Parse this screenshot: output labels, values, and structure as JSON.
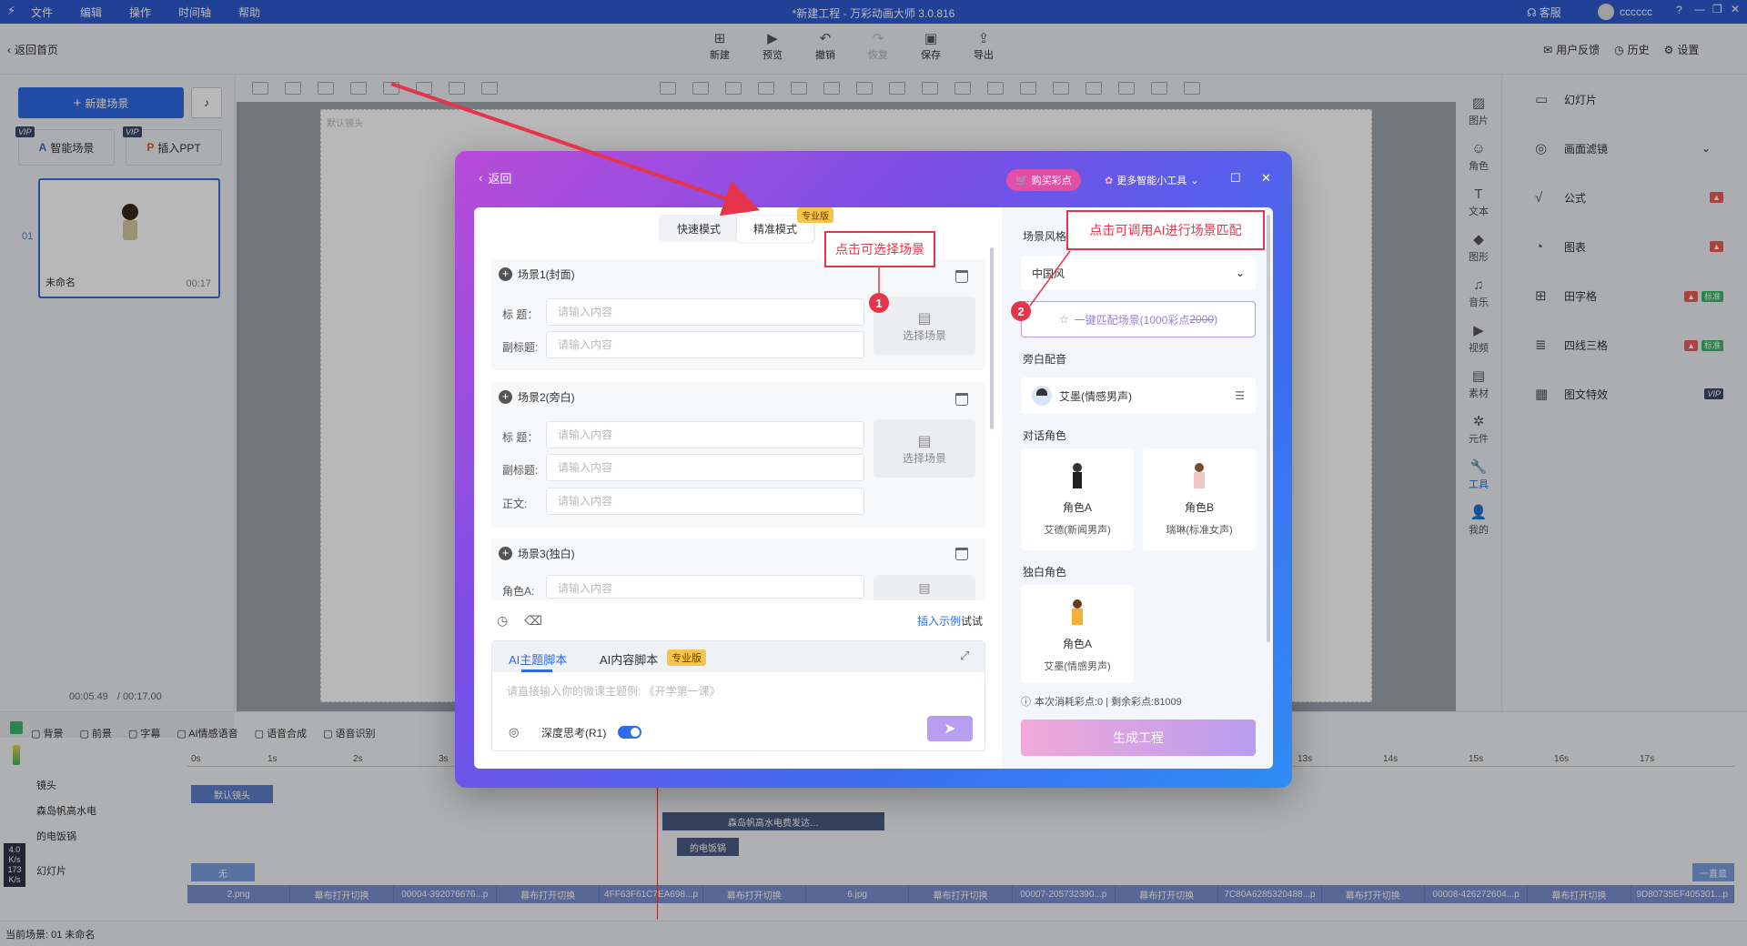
{
  "menubar": {
    "items": [
      "文件",
      "编辑",
      "操作",
      "时间轴",
      "帮助"
    ],
    "title": "*新建工程 - 万彩动画大师 3.0.816",
    "service": "客服",
    "user": "cccccc"
  },
  "toolbar": {
    "back_home": "返回首页",
    "new": "新建",
    "preview": "预览",
    "undo": "撤销",
    "redo": "恢复",
    "save": "保存",
    "export": "导出",
    "feedback": "用户反馈",
    "history": "历史",
    "settings": "设置"
  },
  "left_panel": {
    "new_scene": "新建场景",
    "smart_scene": "智能场景",
    "insert_ppt": "插入PPT",
    "vip": "VIP",
    "scene_index": "01",
    "scene_name": "未命名",
    "scene_duration": "00:17",
    "time_current": "00:05.49",
    "time_total": "/ 00:17.00"
  },
  "canvas": {
    "label": "默认镜头"
  },
  "right_bar": [
    "图片",
    "角色",
    "文本",
    "图形",
    "音乐",
    "视频",
    "素材",
    "元件",
    "工具",
    "我的"
  ],
  "right_panel": [
    {
      "label": "幻灯片",
      "icon": "slideshow-icon",
      "badges": []
    },
    {
      "label": "画面滤镜",
      "icon": "filter-icon",
      "badges": []
    },
    {
      "label": "公式",
      "icon": "formula-icon",
      "badges": [
        "hot"
      ]
    },
    {
      "label": "图表",
      "icon": "chart-icon",
      "badges": [
        "hot"
      ]
    },
    {
      "label": "田字格",
      "icon": "grid-icon",
      "badges": [
        "hot",
        "标准"
      ]
    },
    {
      "label": "四线三格",
      "icon": "lines-icon",
      "badges": [
        "hot",
        "标准"
      ]
    },
    {
      "label": "图文特效",
      "icon": "effect-icon",
      "badges": [
        "VIP"
      ]
    }
  ],
  "timeline": {
    "tabs": [
      "背景",
      "前景",
      "字幕",
      "AI情感语音",
      "语音合成",
      "语音识别"
    ],
    "ticks": [
      "0s",
      "1s",
      "2s",
      "3s",
      "13s",
      "14s",
      "15s",
      "16s",
      "17s"
    ],
    "tracks": [
      "镜头",
      "森岛帆高水电",
      "的电饭锅",
      "幻灯片"
    ],
    "default_lens": "默认镜头",
    "none_label": "无",
    "always_show": "一直显",
    "audio_clip": "森岛帆高水电费发达…",
    "audio_clip2": "的电饭锅",
    "slides": [
      "2.png",
      "幕布打开切换",
      "00004-392076676...p",
      "幕布打开切换",
      "4FF63F61C7EA698...p",
      "幕布打开切换",
      "6.jpg",
      "幕布打开切换",
      "00007-205732390...p",
      "幕布打开切换",
      "7C80A6285320488...p",
      "幕布打开切换",
      "00008-426272604...p",
      "幕布打开切换",
      "9D80735EF405301...p"
    ],
    "net_up": "4.0",
    "net_up_unit": "K/s",
    "net_down": "173",
    "net_down_unit": "K/s"
  },
  "status": {
    "current_scene": "当前场景: 01  未命名"
  },
  "modal": {
    "back": "返回",
    "buy_points": "购买彩点",
    "more_tools": "更多智能小工具",
    "tab_quick": "快速模式",
    "tab_precise": "精准模式",
    "pro_badge": "专业版",
    "title_label": "标 题：",
    "subtitle_label": "副标题:",
    "body_label": "正文:",
    "roleA_label": "角色A:",
    "placeholder": "请输入内容",
    "select_scene": "选择场景",
    "scene1": "场景1(封面)",
    "scene2": "场景2(旁白)",
    "scene3": "场景3(独白)",
    "insert_example": "插入示例",
    "try": "试试",
    "ai_topic": "AI主题脚本",
    "ai_content": "AI内容脚本",
    "prompt_placeholder": "请直接输入你的微课主题例: 《开学第一课》",
    "deep_think": "深度思考(R1)",
    "style_label": "场景风格",
    "style_value": "中国风",
    "match_btn": "一键匹配场景(1000彩点",
    "match_old": "2000",
    "match_close": ")",
    "voice_label": "旁白配音",
    "voice_value": "艾墨(情感男声)",
    "dialog_label": "对话角色",
    "roleA": "角色A",
    "roleA_voice": "艾德(新闻男声)",
    "roleB": "角色B",
    "roleB_voice": "瑞琳(标准女声)",
    "mono_label": "独白角色",
    "mono_role": "角色A",
    "mono_voice": "艾墨(情感男声)",
    "cost": "本次消耗彩点:0 | 剩余彩点:81009",
    "generate": "生成工程"
  },
  "annotations": {
    "callout1": "点击可选择场景",
    "callout2": "点击可调用AI进行场景匹配",
    "num1": "1",
    "num2": "2",
    "color": "#e5354a"
  }
}
